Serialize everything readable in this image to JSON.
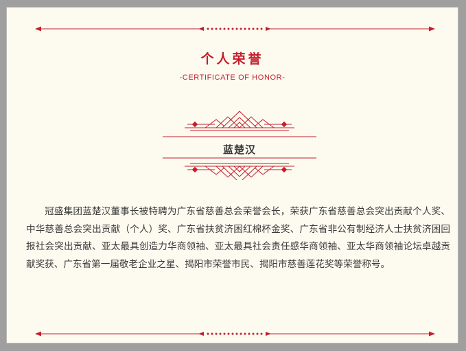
{
  "header": {
    "title": "个人荣誉",
    "subtitle": "-CERTIFICATE OF HONOR-"
  },
  "recipient": {
    "name": "蓝楚汉"
  },
  "content": {
    "paragraph": "冠盛集团蓝楚汉董事长被特聘为广东省慈善总会荣誉会长，荣获广东省慈善总会突出贡献个人奖、中华慈善总会突出贡献（个人）奖、广东省扶贫济困红棉杯金奖、广东省非公有制经济人士扶贫济困回报社会突出贡献、亚太最具创造力华商领袖、亚太最具社会责任感华商领袖、亚太华商领袖论坛卓越贡献奖获、广东省第一届敬老企业之星、揭阳市荣誉市民、揭阳市慈善莲花奖等荣誉称号。"
  },
  "colors": {
    "accent": "#c31e2c",
    "background": "#fdfbf0",
    "text": "#3a3a3a"
  }
}
